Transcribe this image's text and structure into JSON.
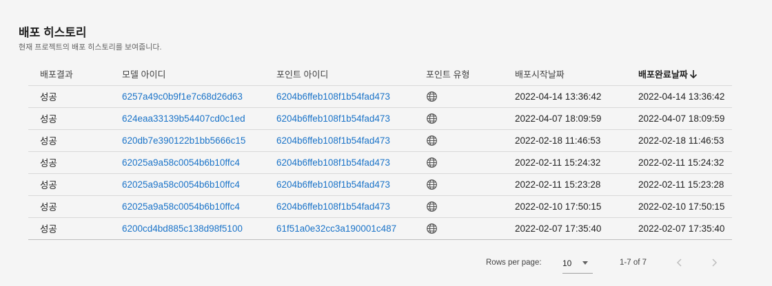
{
  "header": {
    "title": "배포 히스토리",
    "subtitle": "현재 프로젝트의 배포 히스토리를 보여줍니다."
  },
  "table": {
    "columns": [
      "배포결과",
      "모델 아이디",
      "포인트 아이디",
      "포인트 유형",
      "배포시작날짜",
      "배포완료날짜"
    ],
    "sorted_column": "배포완료날짜",
    "sort_direction": "descending",
    "rows": [
      {
        "result": "성공",
        "model_id": "6257a49c0b9f1e7c68d26d63",
        "point_id": "6204b6ffeb108f1b54fad473",
        "point_type": "globe-icon",
        "start": "2022-04-14 13:36:42",
        "end": "2022-04-14 13:36:42"
      },
      {
        "result": "성공",
        "model_id": "624eaa33139b54407cd0c1ed",
        "point_id": "6204b6ffeb108f1b54fad473",
        "point_type": "globe-icon",
        "start": "2022-04-07 18:09:59",
        "end": "2022-04-07 18:09:59"
      },
      {
        "result": "성공",
        "model_id": "620db7e390122b1bb5666c15",
        "point_id": "6204b6ffeb108f1b54fad473",
        "point_type": "globe-icon",
        "start": "2022-02-18 11:46:53",
        "end": "2022-02-18 11:46:53"
      },
      {
        "result": "성공",
        "model_id": "62025a9a58c0054b6b10ffc4",
        "point_id": "6204b6ffeb108f1b54fad473",
        "point_type": "globe-icon",
        "start": "2022-02-11 15:24:32",
        "end": "2022-02-11 15:24:32"
      },
      {
        "result": "성공",
        "model_id": "62025a9a58c0054b6b10ffc4",
        "point_id": "6204b6ffeb108f1b54fad473",
        "point_type": "globe-icon",
        "start": "2022-02-11 15:23:28",
        "end": "2022-02-11 15:23:28"
      },
      {
        "result": "성공",
        "model_id": "62025a9a58c0054b6b10ffc4",
        "point_id": "6204b6ffeb108f1b54fad473",
        "point_type": "globe-icon",
        "start": "2022-02-10 17:50:15",
        "end": "2022-02-10 17:50:15"
      },
      {
        "result": "성공",
        "model_id": "6200cd4bd885c138d98f5100",
        "point_id": "61f51a0e32cc3a190001c487",
        "point_type": "globe-icon",
        "start": "2022-02-07 17:35:40",
        "end": "2022-02-07 17:35:40"
      }
    ]
  },
  "pagination": {
    "rows_per_page_label": "Rows per page:",
    "rows_per_page": "10",
    "range": "1-7 of 7"
  },
  "colors": {
    "link": "#1a73c8",
    "background": "#f5f5f5",
    "divider": "#d8d8d8"
  }
}
